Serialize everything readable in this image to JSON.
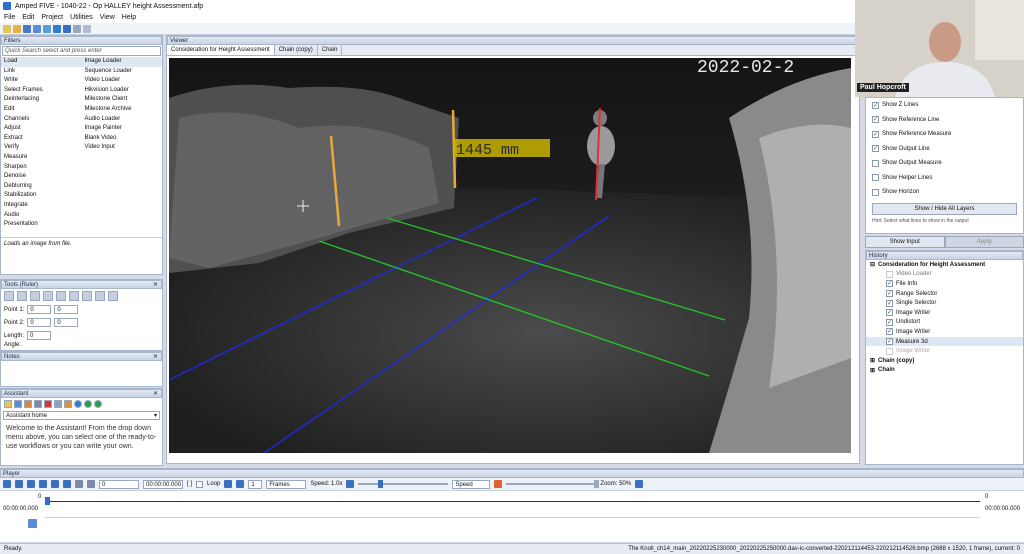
{
  "window": {
    "title": "Amped FIVE - 1040-22 - Op HALLEY height Assessment.afp"
  },
  "menu": [
    "File",
    "Edit",
    "Project",
    "Utilities",
    "View",
    "Help"
  ],
  "filters": {
    "header": "Filters",
    "search_placeholder": "Quick Search select and press enter",
    "categories": [
      "Load",
      "Link",
      "Write",
      "Select Frames",
      "Deinterlacing",
      "Edit",
      "Channels",
      "Adjust",
      "Extract",
      "Verify",
      "Measure",
      "Sharpen",
      "Denoise",
      "Deblurring",
      "Stabilization",
      "Integrate",
      "Audio",
      "Presentation"
    ],
    "items": [
      "Image Loader",
      "Sequence Loader",
      "Video Loader",
      "Hikvision Loader",
      "Milestone Client",
      "Milestone Archive",
      "Audio Loader",
      "Image Painter",
      "Blank Video",
      "Video Input"
    ],
    "description": "Loads an image from file."
  },
  "tools": {
    "header": "Tools (Ruler)",
    "point1_label": "Point 1:",
    "point1_x": "0",
    "point1_y": "0",
    "point2_label": "Point 2:",
    "point2_x": "0",
    "point2_y": "0",
    "length_label": "Length:",
    "length_value": "0",
    "angle_label": "Angle:"
  },
  "notes": {
    "header": "Notes"
  },
  "assistant": {
    "header": "Assistant",
    "select_value": "Assistant home",
    "text": "Welcome to the Assistant! From the drop down menu above, you can select one of the ready-to-use workflows or you can write your own."
  },
  "viewer": {
    "header": "Viewer",
    "tabs": [
      "Consideration for Height Assessment",
      "Chain (copy)",
      "Chain"
    ],
    "timestamp": "2022-02-2",
    "measure_label": "1445 mm"
  },
  "right_panel": {
    "options": [
      {
        "label": "Show Z Lines",
        "checked": true
      },
      {
        "label": "Show Reference Line",
        "checked": true
      },
      {
        "label": "Show Reference Measure",
        "checked": true
      },
      {
        "label": "Show Output Line",
        "checked": true
      },
      {
        "label": "Show Output Measure",
        "checked": false
      },
      {
        "label": "Show Helper Lines",
        "checked": false
      },
      {
        "label": "Show Horizon",
        "checked": false
      }
    ],
    "toggle_button": "Show / Hide All Layers",
    "hint": "Hint: Select what lines to show in the output",
    "show_input_button": "Show Input",
    "apply_button": "Apply"
  },
  "history": {
    "header": "History",
    "chain_name": "Consideration for Height Assessment",
    "entries": [
      "Video Loader",
      "File Info",
      "Range Selector",
      "Single Selector",
      "Image Writer",
      "Undistort",
      "Image Writer",
      "Measure 3d",
      "Image Writer"
    ],
    "other_chains": [
      "Chain (copy)",
      "Chain"
    ]
  },
  "webcam": {
    "name": "Paul Hopcroft"
  },
  "player": {
    "header": "Player",
    "frame": "0",
    "time": "00:00:00.000",
    "loop_label": "Loop",
    "step": "1",
    "unit": "Frames",
    "speed_label": "Speed: 1.0x",
    "speed_select": "Speed",
    "zoom_label": "Zoom: 50%",
    "timeline_start": "00:00:00.000",
    "timeline_end": "00:00:00.000",
    "marker_left": "0",
    "marker_right": "0"
  },
  "status": {
    "left": "Ready.",
    "right": "The Knoll_ch14_main_20220225230000_20220225250000.dav-ic-converted-220212114453-220212114526.bmp (2688 x 1520, 1 frame), current: 0"
  },
  "colors": {
    "reference_line": "#e8a93a",
    "output_line": "#e03030",
    "z_lines": "#1b2be0",
    "ground_lines": "#22c02a",
    "measure_label_bg": "#c8b400"
  }
}
